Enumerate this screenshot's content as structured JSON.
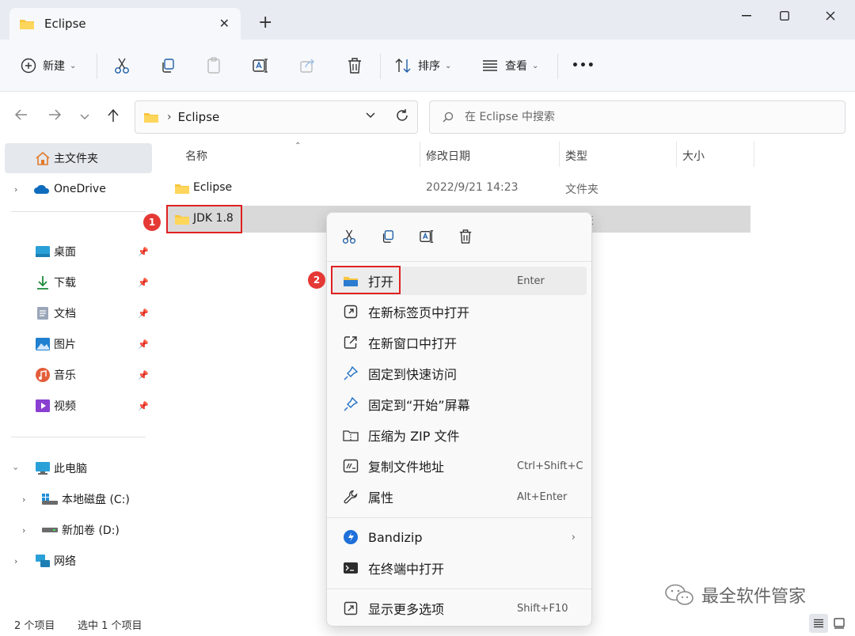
{
  "window": {
    "tab_title": "Eclipse",
    "new_tab": "+",
    "minimize": "—",
    "maximize": "☐",
    "close": "✕"
  },
  "toolbar": {
    "new_label": "新建",
    "sort_label": "排序",
    "view_label": "查看",
    "more_label": "•••"
  },
  "address": {
    "path": "Eclipse",
    "search_placeholder": "在 Eclipse 中搜索"
  },
  "sidebar": {
    "home": "主文件夹",
    "onedrive": "OneDrive",
    "quick": [
      {
        "label": "桌面"
      },
      {
        "label": "下载"
      },
      {
        "label": "文档"
      },
      {
        "label": "图片"
      },
      {
        "label": "音乐"
      },
      {
        "label": "视频"
      }
    ],
    "this_pc": "此电脑",
    "drive_c": "本地磁盘 (C:)",
    "drive_d": "新加卷 (D:)",
    "network": "网络"
  },
  "columns": {
    "name": "名称",
    "modified": "修改日期",
    "type": "类型",
    "size": "大小"
  },
  "files": [
    {
      "name": "Eclipse",
      "modified": "2022/9/21 14:23",
      "type": "文件夹"
    },
    {
      "name": "JDK 1.8",
      "modified": "",
      "type": "夹"
    }
  ],
  "callouts": {
    "step1": "1",
    "step2": "2"
  },
  "context_menu": {
    "items": [
      {
        "label": "打开",
        "accel": "Enter"
      },
      {
        "label": "在新标签页中打开",
        "accel": ""
      },
      {
        "label": "在新窗口中打开",
        "accel": ""
      },
      {
        "label": "固定到快速访问",
        "accel": ""
      },
      {
        "label": "固定到“开始”屏幕",
        "accel": ""
      },
      {
        "label": "压缩为 ZIP 文件",
        "accel": ""
      },
      {
        "label": "复制文件地址",
        "accel": "Ctrl+Shift+C"
      },
      {
        "label": "属性",
        "accel": "Alt+Enter"
      },
      {
        "label": "Bandizip",
        "accel": ""
      },
      {
        "label": "在终端中打开",
        "accel": ""
      },
      {
        "label": "显示更多选项",
        "accel": "Shift+F10"
      }
    ]
  },
  "status": {
    "item_count": "2 个项目",
    "selected": "选中 1 个项目"
  },
  "watermark": "最全软件管家",
  "colors": {
    "accent": "#0067c0",
    "folder": "#f8c640",
    "callout_red": "#e02020"
  }
}
